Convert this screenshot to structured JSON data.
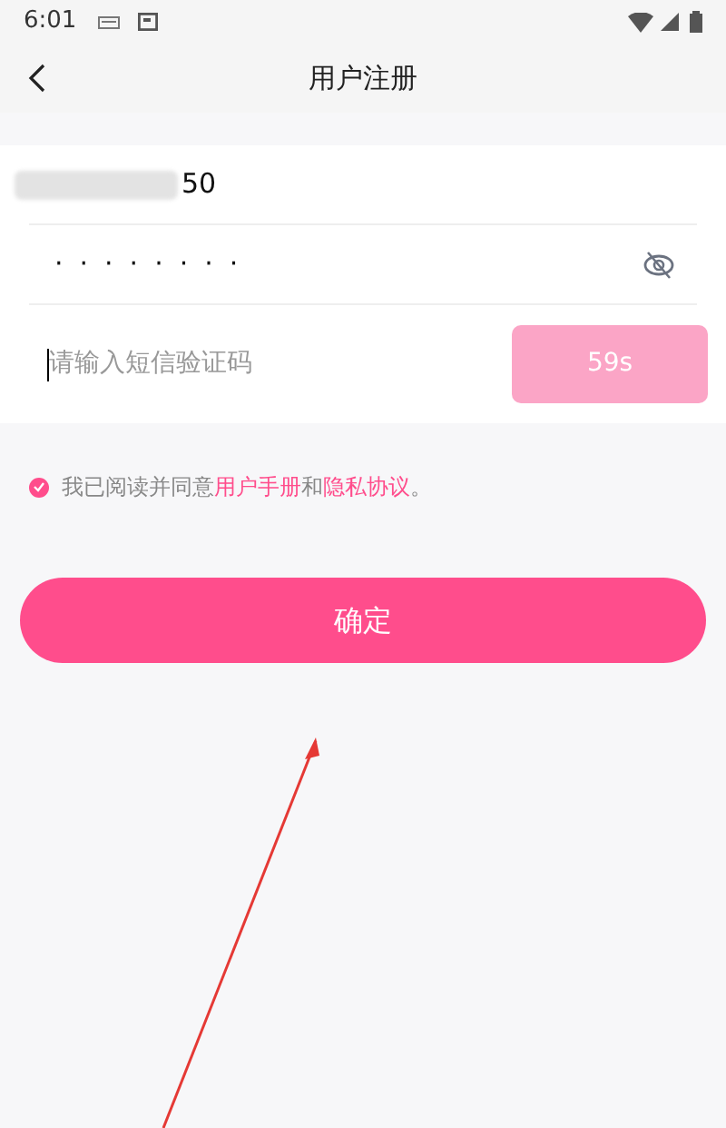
{
  "status_bar": {
    "time": "6:01"
  },
  "header": {
    "title": "用户注册"
  },
  "form": {
    "phone": {
      "value": "50",
      "redacted": true
    },
    "password": {
      "value": "········",
      "visible": false
    },
    "sms_code": {
      "placeholder": "请输入短信验证码",
      "focused": true
    },
    "countdown_button": {
      "label": "59s",
      "disabled": true
    }
  },
  "agreement": {
    "checked": true,
    "parts": [
      {
        "kind": "text",
        "text": "我已阅读并同意"
      },
      {
        "kind": "link",
        "text": "用户手册"
      },
      {
        "kind": "text",
        "text": "和"
      },
      {
        "kind": "link",
        "text": "隐私协议"
      },
      {
        "kind": "text",
        "text": "。"
      }
    ]
  },
  "submit_button": {
    "label": "确定"
  },
  "annotation": {
    "kind": "arrow"
  }
}
